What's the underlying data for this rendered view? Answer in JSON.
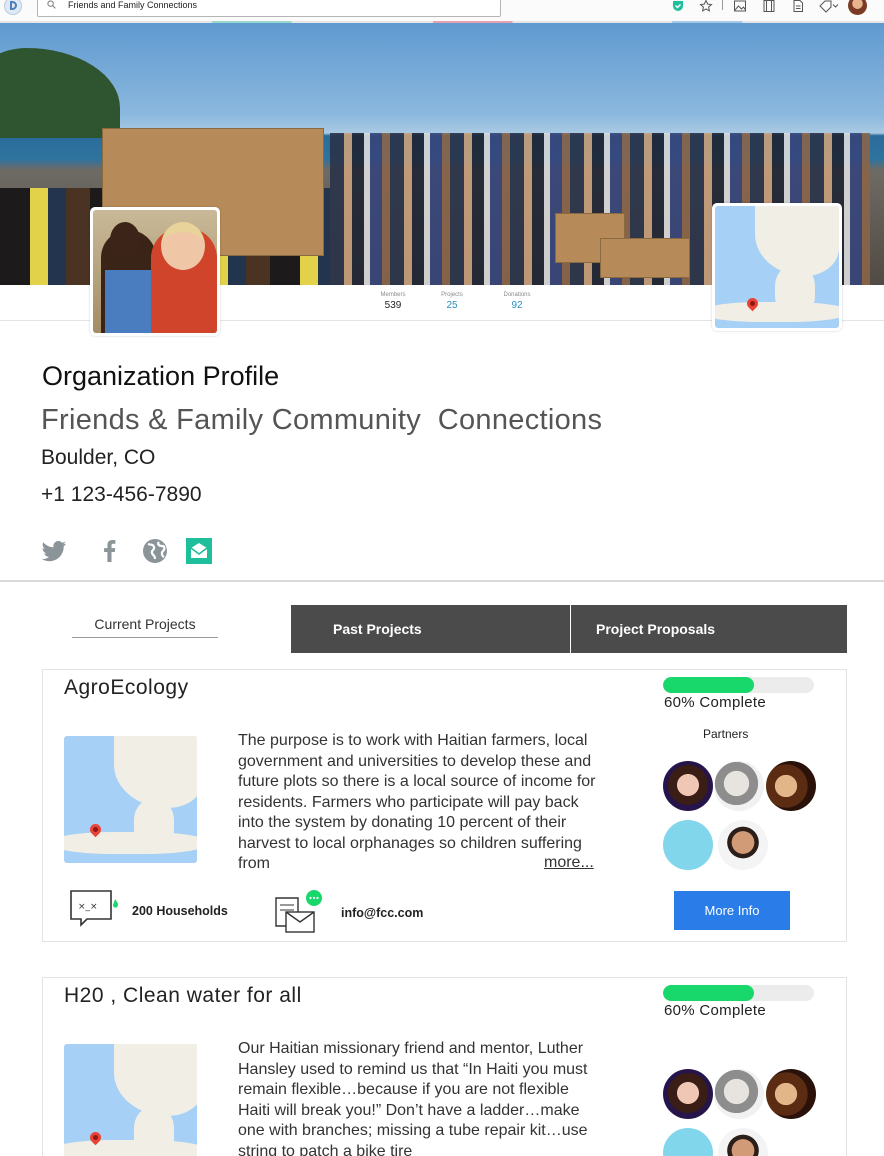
{
  "browser": {
    "url_text": "Friends and Family Connections",
    "toolbar_icons": [
      "app-logo-icon",
      "search-icon",
      "shield-check-icon",
      "star-icon",
      "image-icon",
      "film-icon",
      "document-icon",
      "tag-icon",
      "account-avatar"
    ]
  },
  "stats": {
    "members_label": "Members",
    "members_value": "539",
    "projects_label": "Projects",
    "projects_value": "25",
    "donations_label": "Donations",
    "donations_value": "92",
    "value_color_default": "#222222",
    "value_color_link": "#2a8ec0"
  },
  "org": {
    "heading": "Organization Profile",
    "name": "Friends & Family Community  Connections",
    "location": "Boulder, CO",
    "phone": "+1 123-456-7890",
    "social_icons": [
      "twitter-icon",
      "facebook-icon",
      "globe-icon",
      "email-icon"
    ],
    "email_icon_color": "#1fbf9c"
  },
  "tabs": {
    "current": "Current Projects",
    "past": "Past Projects",
    "proposals": "Project Proposals"
  },
  "projects": [
    {
      "title": "AgroEcology",
      "progress_percent": 60,
      "progress_label": "60% Complete",
      "partners_label": "Partners",
      "description": "The purpose is to work with Haitian farmers, local government and universities to develop these and future plots so there is a local source of income for residents. Farmers who participate will pay back into the system by donating 10 percent of their harvest to local orphanages so children suffering from",
      "more_link": "more...",
      "households": "200 Households",
      "email": "info@fcc.com",
      "button": "More Info"
    },
    {
      "title": "H20 , Clean water for all",
      "progress_percent": 60,
      "progress_label": "60% Complete",
      "description": "Our Haitian missionary friend and mentor, Luther Hansley used to remind us that “In Haiti you must remain flexible…because if you are not flexible Haiti will break you!” Don’t have a ladder…make one with branches; missing a tube repair kit…use string to patch a bike tire"
    }
  ],
  "colors": {
    "progress_fill": "#19d86b",
    "button_blue": "#2a7de8",
    "tab_dark": "#4b4b4b"
  }
}
